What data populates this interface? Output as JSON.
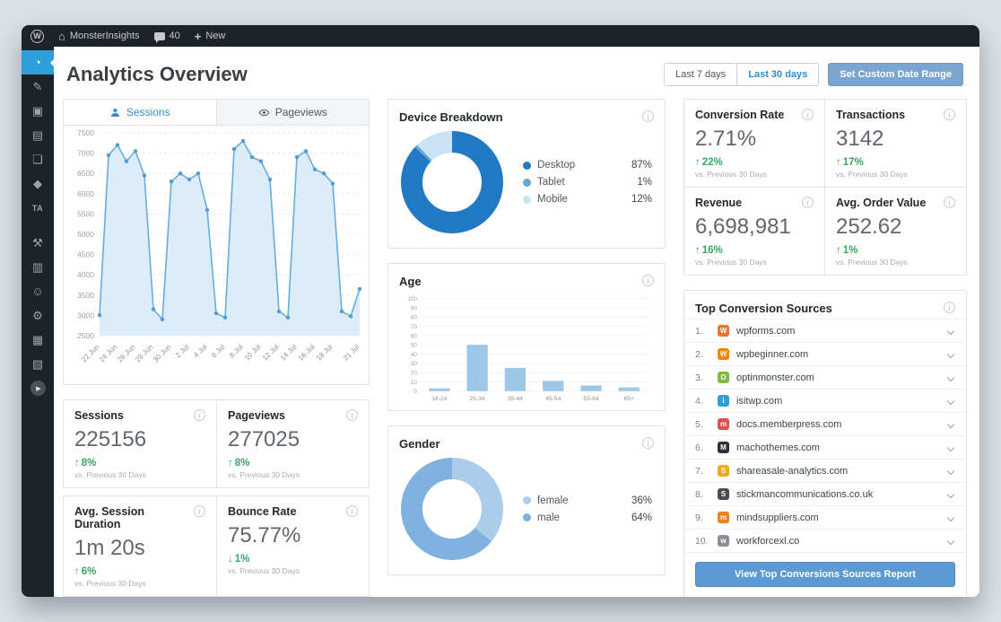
{
  "icons": {
    "wordpress": "W",
    "home": "⌂",
    "plus": "+",
    "info": "i"
  },
  "admin_bar": {
    "site_name": "MonsterInsights",
    "comments": "40",
    "new_label": "New"
  },
  "sidebar": {
    "items": [
      {
        "name": "monsterinsights",
        "glyph": "◔"
      },
      {
        "name": "posts-pin",
        "glyph": "✎"
      },
      {
        "name": "media",
        "glyph": "▣"
      },
      {
        "name": "pages",
        "glyph": "▤"
      },
      {
        "name": "comments",
        "glyph": "❏"
      },
      {
        "name": "shield",
        "glyph": "◆"
      },
      {
        "name": "ta-plugin",
        "glyph": "TA"
      },
      {
        "name": "tools-hammer",
        "glyph": "⚒"
      },
      {
        "name": "charts",
        "glyph": "▥"
      },
      {
        "name": "users",
        "glyph": "☺"
      },
      {
        "name": "settings-wrench",
        "glyph": "⚙"
      },
      {
        "name": "layout-grid",
        "glyph": "▦"
      },
      {
        "name": "gallery",
        "glyph": "▧"
      },
      {
        "name": "video-tutorial",
        "glyph": "▶"
      }
    ]
  },
  "header": {
    "title": "Analytics Overview",
    "range7": "Last 7 days",
    "range30": "Last 30 days",
    "custom_range": "Set Custom Date Range"
  },
  "tabs": {
    "sessions": "Sessions",
    "pageviews": "Pageviews"
  },
  "stats": [
    {
      "label": "Sessions",
      "value": "225156",
      "arrow": "↑",
      "delta": "8%",
      "compare": "vs. Previous 30 Days"
    },
    {
      "label": "Pageviews",
      "value": "277025",
      "arrow": "↑",
      "delta": "8%",
      "compare": "vs. Previous 30 Days"
    },
    {
      "label": "Avg. Session Duration",
      "value": "1m 20s",
      "arrow": "↑",
      "delta": "6%",
      "compare": "vs. Previous 30 Days"
    },
    {
      "label": "Bounce Rate",
      "value": "75.77%",
      "arrow": "↓",
      "delta": "1%",
      "compare": "vs. Previous 30 Days"
    }
  ],
  "ecommerce": [
    {
      "label": "Conversion Rate",
      "value": "2.71%",
      "arrow": "↑",
      "delta": "22%",
      "compare": "vs. Previous 30 Days"
    },
    {
      "label": "Transactions",
      "value": "3142",
      "arrow": "↑",
      "delta": "17%",
      "compare": "vs. Previous 30 Days"
    },
    {
      "label": "Revenue",
      "value": "6,698,981",
      "arrow": "↑",
      "delta": "16%",
      "compare": "vs. Previous 30 Days"
    },
    {
      "label": "Avg. Order Value",
      "value": "252.62",
      "arrow": "↑",
      "delta": "1%",
      "compare": "vs. Previous 30 Days"
    }
  ],
  "sources": {
    "title": "Top Conversion Sources",
    "items": [
      {
        "rank": "1.",
        "domain": "wpforms.com",
        "color": "#e27730",
        "initial": "W"
      },
      {
        "rank": "2.",
        "domain": "wpbeginner.com",
        "color": "#f18500",
        "initial": "W"
      },
      {
        "rank": "3.",
        "domain": "optinmonster.com",
        "color": "#7dbb42",
        "initial": "O"
      },
      {
        "rank": "4.",
        "domain": "isitwp.com",
        "color": "#2d9fd8",
        "initial": "i"
      },
      {
        "rank": "5.",
        "domain": "docs.memberpress.com",
        "color": "#d9534f",
        "initial": "m"
      },
      {
        "rank": "6.",
        "domain": "machothemes.com",
        "color": "#2c3338",
        "initial": "M"
      },
      {
        "rank": "7.",
        "domain": "shareasale-analytics.com",
        "color": "#f5a623",
        "initial": "S"
      },
      {
        "rank": "8.",
        "domain": "stickmancommunications.co.uk",
        "color": "#4a4f54",
        "initial": "S"
      },
      {
        "rank": "9.",
        "domain": "mindsuppliers.com",
        "color": "#f0821e",
        "initial": "m"
      },
      {
        "rank": "10.",
        "domain": "workforcexl.co",
        "color": "#8a9096",
        "initial": "w"
      }
    ],
    "button": "View Top Conversions Sources Report"
  },
  "chart_data": [
    {
      "id": "sessions-over-time",
      "type": "line",
      "title": "Sessions",
      "x": [
        "22 Jun",
        "23 Jun",
        "24 Jun",
        "25 Jun",
        "26 Jun",
        "27 Jun",
        "28 Jun",
        "29 Jun",
        "30 Jun",
        "1 Jul",
        "2 Jul",
        "3 Jul",
        "4 Jul",
        "5 Jul",
        "6 Jul",
        "7 Jul",
        "8 Jul",
        "9 Jul",
        "10 Jul",
        "11 Jul",
        "12 Jul",
        "13 Jul",
        "14 Jul",
        "15 Jul",
        "16 Jul",
        "17 Jul",
        "18 Jul",
        "19 Jul",
        "20 Jul",
        "21 Jul"
      ],
      "values": [
        3005,
        6950,
        7200,
        6800,
        7050,
        6450,
        3150,
        2900,
        6300,
        6500,
        6350,
        6500,
        5600,
        3050,
        2950,
        7100,
        7300,
        6900,
        6800,
        6350,
        3100,
        2950,
        6900,
        7050,
        6600,
        6500,
        6250,
        3100,
        2980,
        3650
      ],
      "label_indices": [
        0,
        2,
        4,
        6,
        8,
        10,
        12,
        14,
        16,
        18,
        20,
        22,
        24,
        26,
        29
      ],
      "ylim": [
        2500,
        7500
      ],
      "ytick_step": 500,
      "grid": "dashed horizontal",
      "line_color": "#69acdd",
      "fill_color": "#dcecf9",
      "point_color": "#549bd4"
    },
    {
      "id": "device-breakdown",
      "type": "pie",
      "title": "Device Breakdown",
      "labels": [
        "Desktop",
        "Tablet",
        "Mobile"
      ],
      "values": [
        87,
        1,
        12
      ],
      "pct": [
        "87%",
        "1%",
        "12%"
      ],
      "colors": [
        "#2079c2",
        "#61a7db",
        "#c9e2f4"
      ],
      "donut": true,
      "legend_position": "right"
    },
    {
      "id": "age",
      "type": "bar",
      "title": "Age",
      "categories": [
        "18-24",
        "25-34",
        "35-44",
        "45-54",
        "55-64",
        "65+"
      ],
      "values": [
        3,
        50,
        25,
        11,
        6,
        4
      ],
      "ylim": [
        0,
        100
      ],
      "ytick_step": 10,
      "bar_color": "#9cc7e6"
    },
    {
      "id": "gender",
      "type": "pie",
      "title": "Gender",
      "labels": [
        "female",
        "male"
      ],
      "values": [
        36,
        64
      ],
      "pct": [
        "36%",
        "64%"
      ],
      "colors": [
        "#abcdea",
        "#7fb2de"
      ],
      "donut": true,
      "legend_position": "right"
    }
  ]
}
